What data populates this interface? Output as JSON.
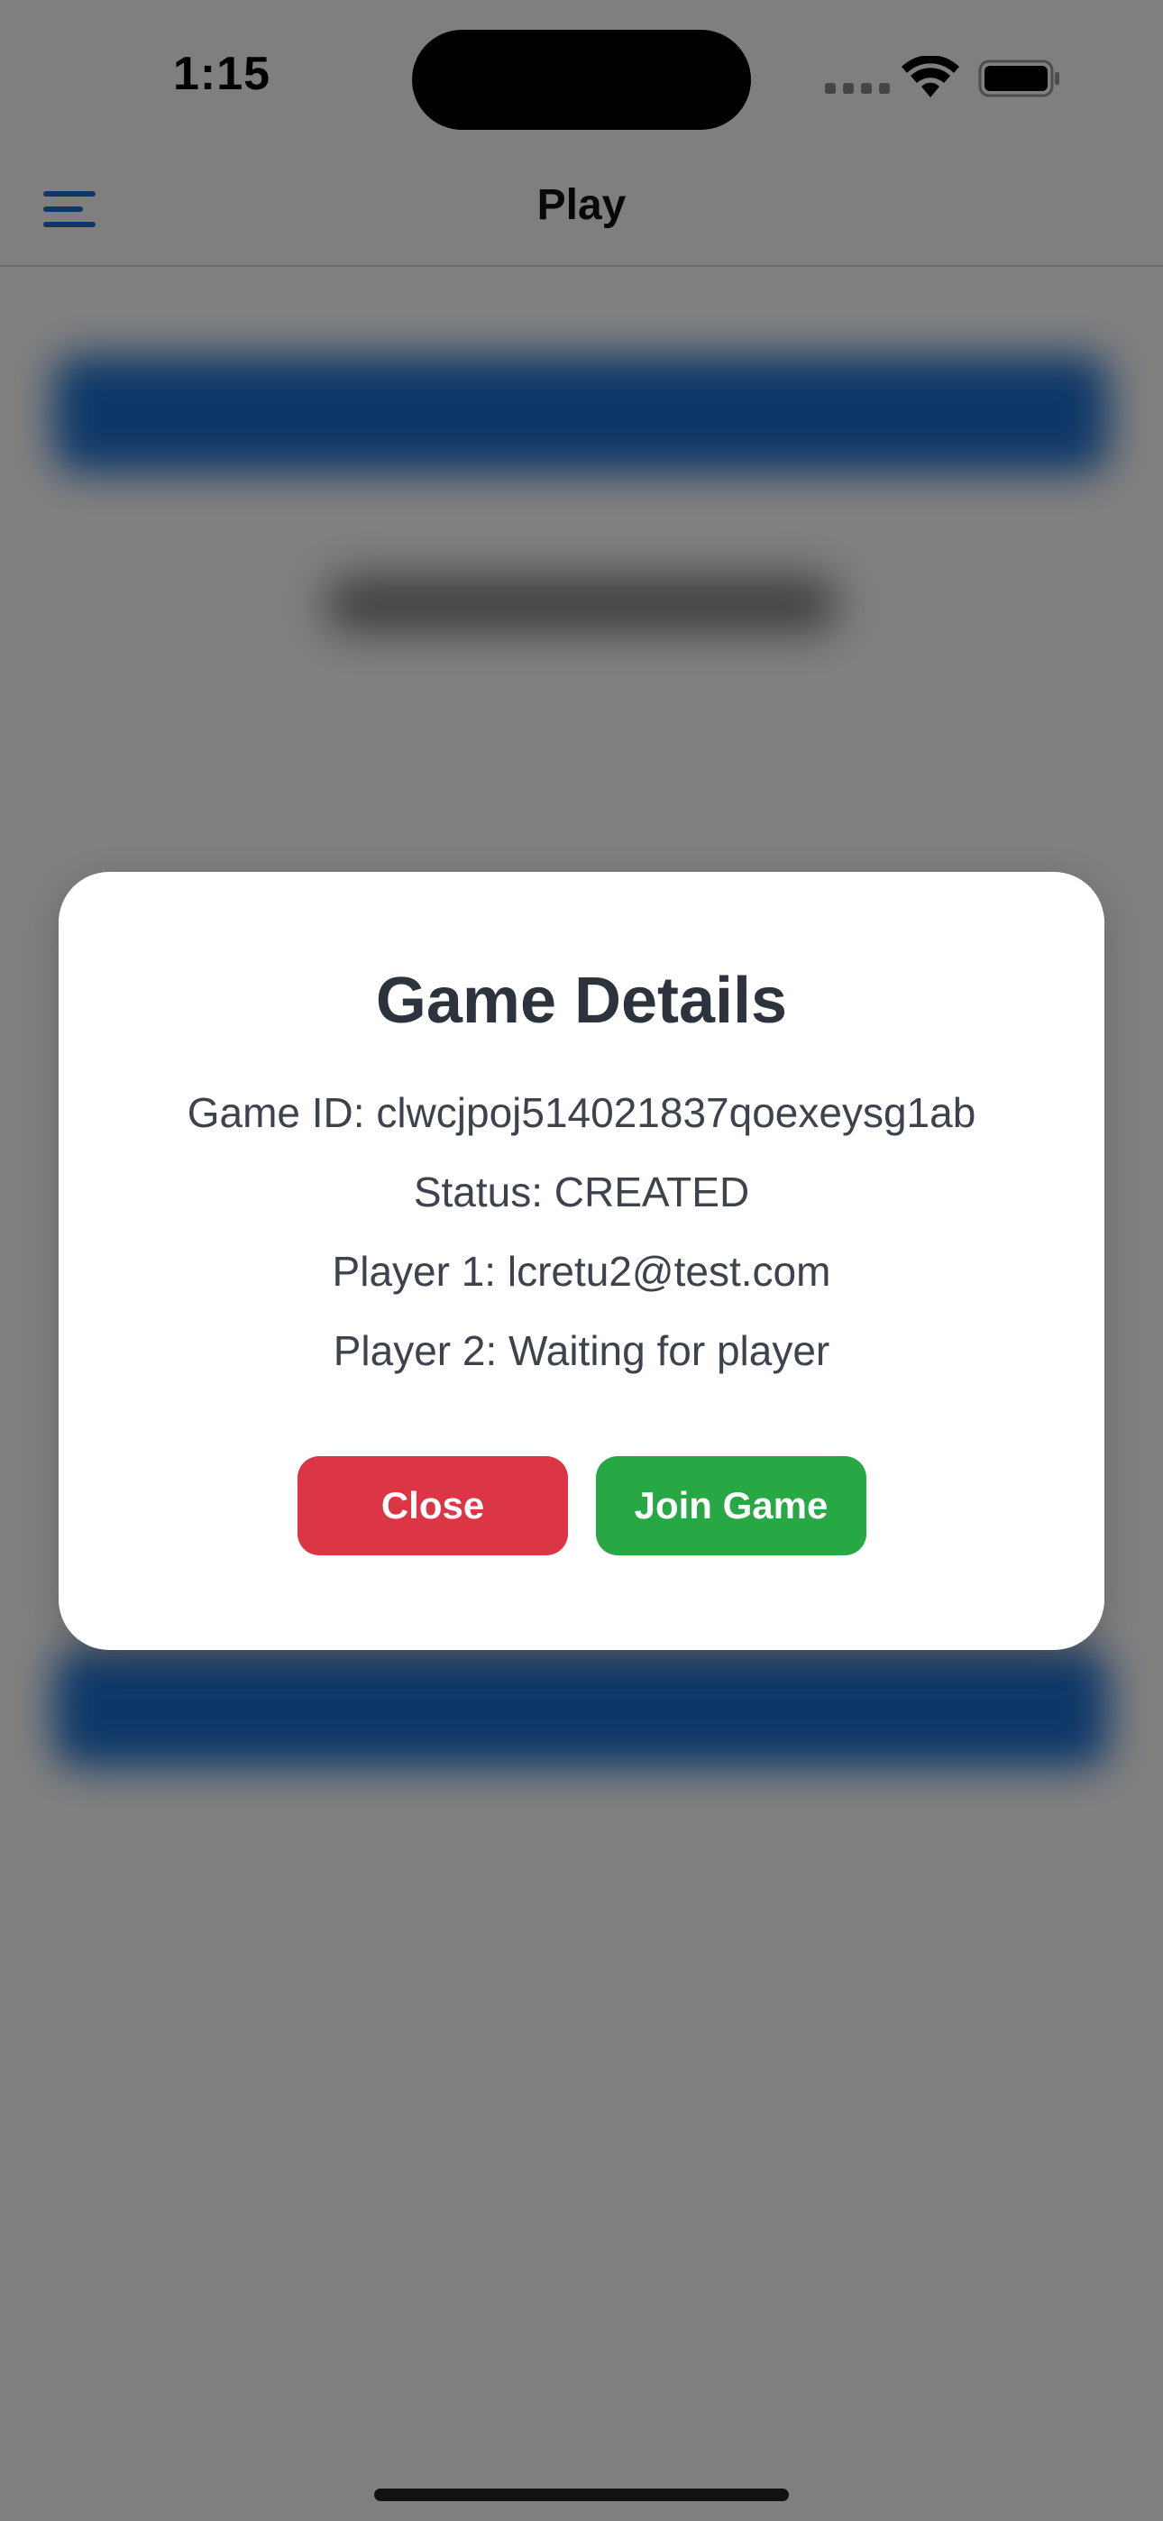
{
  "status_bar": {
    "time": "1:15"
  },
  "nav": {
    "title": "Play",
    "menu_icon": "hamburger-menu-icon"
  },
  "modal": {
    "title": "Game Details",
    "game_id": "Game ID: clwcjpoj514021837qoexeysg1ab",
    "status": "Status: CREATED",
    "player1": "Player 1: lcretu2@test.com",
    "player2": "Player 2: Waiting for player",
    "close_label": "Close",
    "join_label": "Join Game"
  },
  "colors": {
    "accent": "#1d6fd0",
    "close_button": "#dc3545",
    "join_button": "#28a745",
    "overlay": "rgba(0,0,0,0.5)"
  }
}
